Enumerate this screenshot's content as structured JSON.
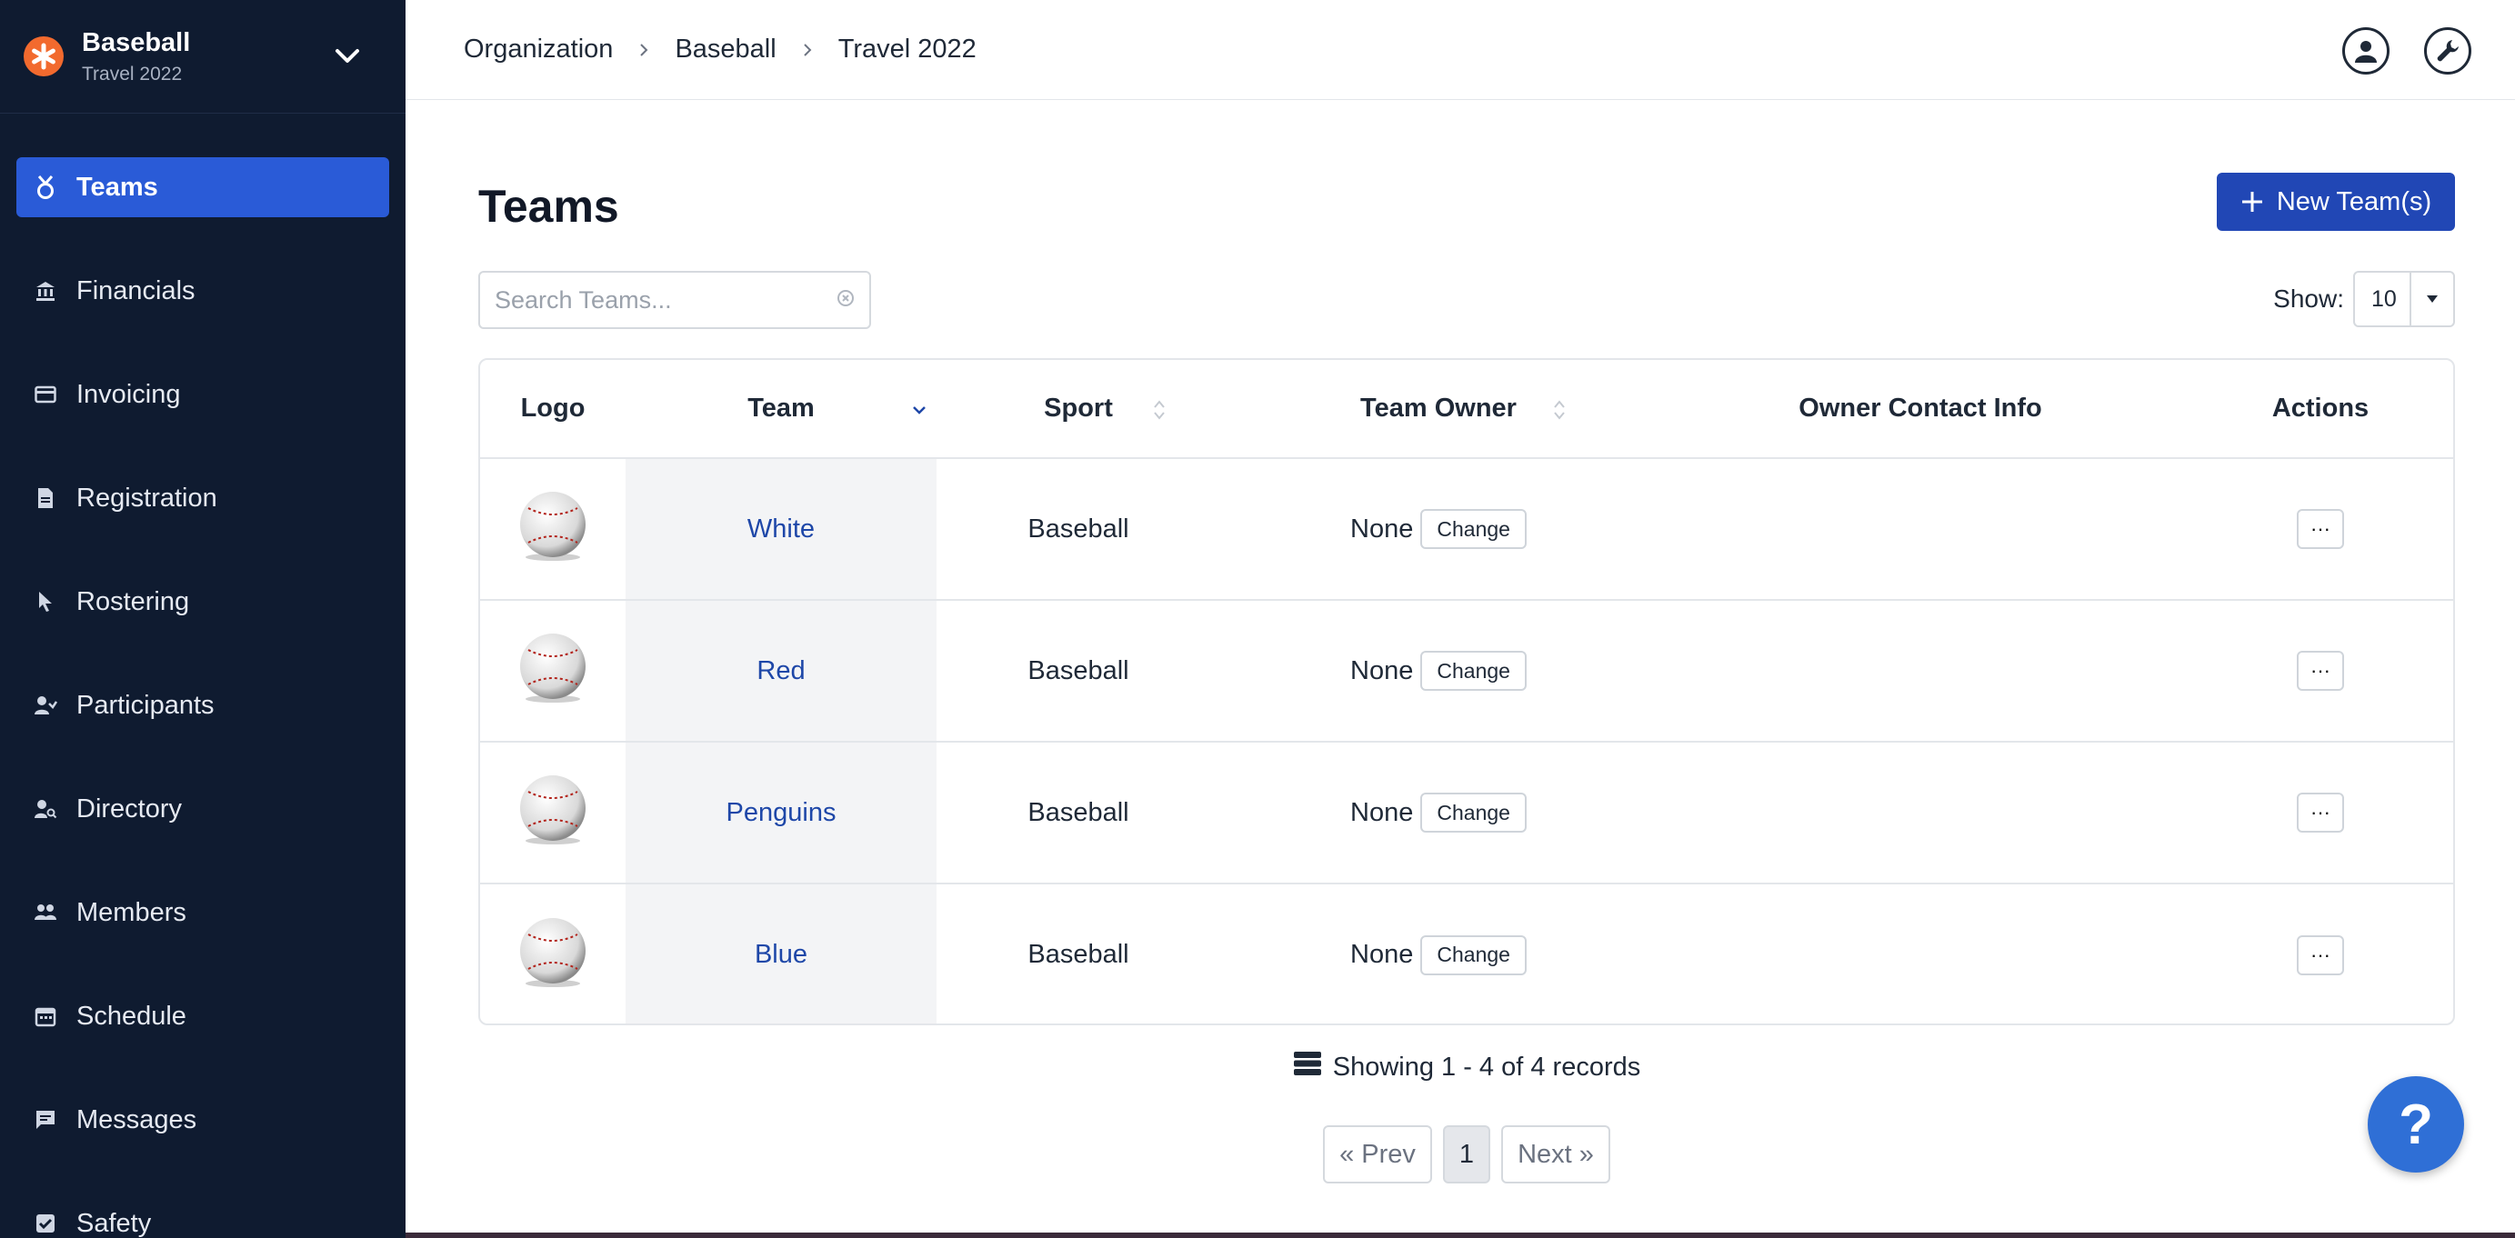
{
  "org": {
    "name": "Baseball",
    "subtitle": "Travel 2022"
  },
  "sidebar": {
    "items": [
      {
        "label": "Teams",
        "icon": "medal-icon",
        "active": true
      },
      {
        "label": "Financials",
        "icon": "bank-icon"
      },
      {
        "label": "Invoicing",
        "icon": "card-icon"
      },
      {
        "label": "Registration",
        "icon": "document-icon"
      },
      {
        "label": "Rostering",
        "icon": "cursor-icon"
      },
      {
        "label": "Participants",
        "icon": "participants-icon"
      },
      {
        "label": "Directory",
        "icon": "person-search-icon"
      },
      {
        "label": "Members",
        "icon": "members-icon"
      },
      {
        "label": "Schedule",
        "icon": "calendar-icon"
      },
      {
        "label": "Messages",
        "icon": "message-icon"
      },
      {
        "label": "Safety",
        "icon": "check-badge-icon"
      }
    ]
  },
  "breadcrumb": [
    "Organization",
    "Baseball",
    "Travel 2022"
  ],
  "page": {
    "title": "Teams",
    "new_button": "New Team(s)",
    "search_placeholder": "Search Teams...",
    "show_label": "Show:",
    "show_value": "10"
  },
  "table": {
    "headers": [
      "Logo",
      "Team",
      "Sport",
      "Team Owner",
      "Owner Contact Info",
      "Actions"
    ],
    "rows": [
      {
        "team": "White",
        "sport": "Baseball",
        "owner": "None",
        "change": "Change",
        "actions": "···"
      },
      {
        "team": "Red",
        "sport": "Baseball",
        "owner": "None",
        "change": "Change",
        "actions": "···"
      },
      {
        "team": "Penguins",
        "sport": "Baseball",
        "owner": "None",
        "change": "Change",
        "actions": "···"
      },
      {
        "team": "Blue",
        "sport": "Baseball",
        "owner": "None",
        "change": "Change",
        "actions": "···"
      }
    ]
  },
  "footer": {
    "records": "Showing 1 - 4 of 4 records",
    "prev": "« Prev",
    "page": "1",
    "next": "Next »"
  },
  "help": "?",
  "colors": {
    "sidebar": "#0f1b30",
    "accent": "#2a5bd7",
    "button": "#2147b5",
    "link": "#1e47a8",
    "org_logo": "#f26a2e"
  }
}
